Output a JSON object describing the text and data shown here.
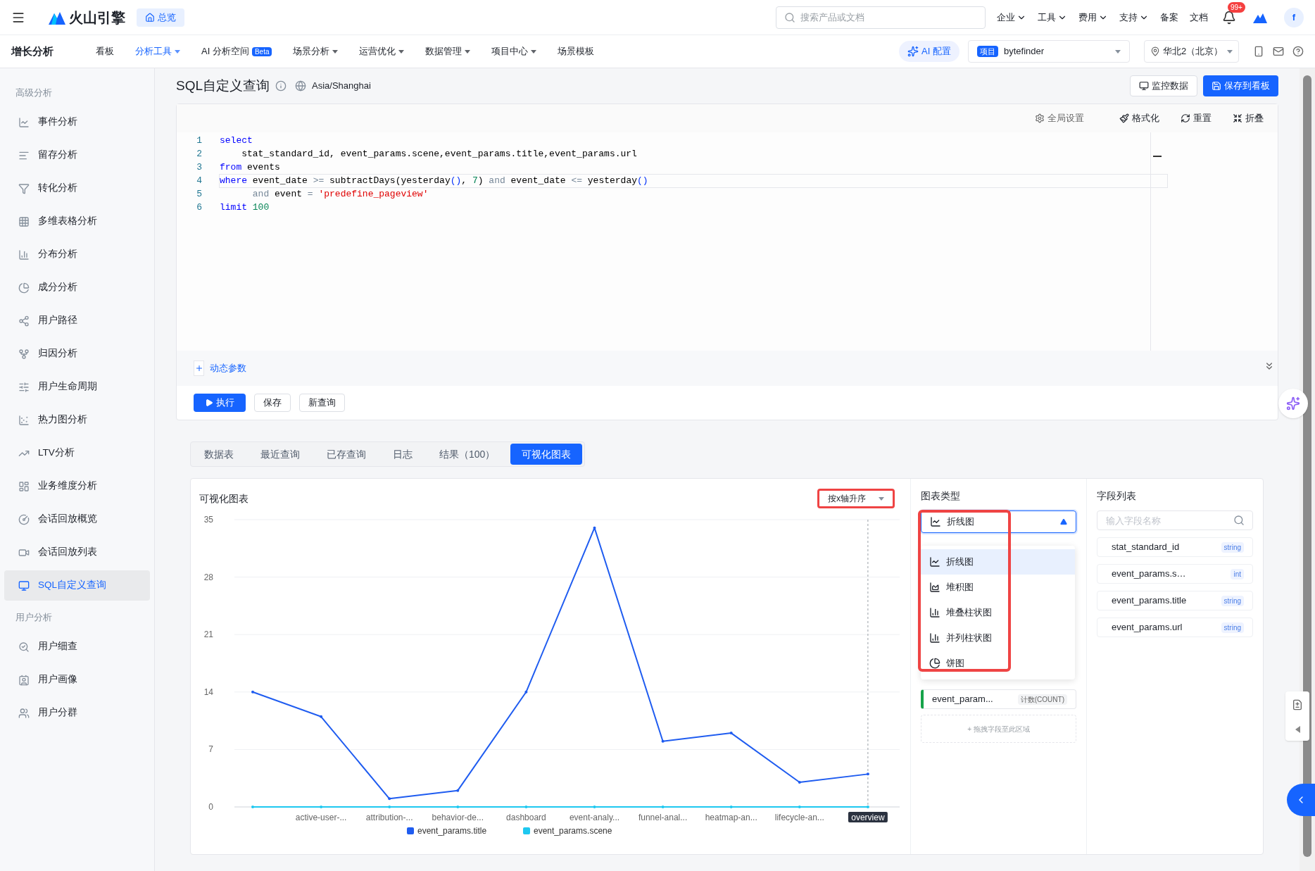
{
  "topbar": {
    "brand": "火山引擎",
    "overview_button": "总览",
    "search": {
      "placeholder": "搜索产品或文档"
    },
    "menus": [
      {
        "label": "企业",
        "dropdown": true
      },
      {
        "label": "工具",
        "dropdown": true
      },
      {
        "label": "费用",
        "dropdown": true
      },
      {
        "label": "支持",
        "dropdown": true
      },
      {
        "label": "备案",
        "dropdown": false
      },
      {
        "label": "文档",
        "dropdown": false
      }
    ],
    "notification_badge": "99+",
    "avatar": "f"
  },
  "navbar": {
    "title": "增长分析",
    "items": [
      {
        "label": "看板",
        "selected": false,
        "dropdown": false
      },
      {
        "label": "分析工具",
        "selected": true,
        "dropdown": true
      },
      {
        "label": "AI 分析空间",
        "selected": false,
        "dropdown": false,
        "badge": "Beta"
      },
      {
        "label": "场景分析",
        "selected": false,
        "dropdown": true
      },
      {
        "label": "运营优化",
        "selected": false,
        "dropdown": true
      },
      {
        "label": "数据管理",
        "selected": false,
        "dropdown": true
      },
      {
        "label": "项目中心",
        "selected": false,
        "dropdown": true
      },
      {
        "label": "场景模板",
        "selected": false,
        "dropdown": false
      }
    ],
    "ai_button": "AI 配置",
    "project": {
      "tag": "项目",
      "value": "bytefinder"
    },
    "region": "华北2（北京）"
  },
  "sidebar": {
    "sections": [
      {
        "title": "高级分析",
        "items": [
          {
            "label": "事件分析",
            "selected": false
          },
          {
            "label": "留存分析",
            "selected": false
          },
          {
            "label": "转化分析",
            "selected": false
          },
          {
            "label": "多维表格分析",
            "selected": false
          },
          {
            "label": "分布分析",
            "selected": false
          },
          {
            "label": "成分分析",
            "selected": false
          },
          {
            "label": "用户路径",
            "selected": false
          },
          {
            "label": "归因分析",
            "selected": false
          },
          {
            "label": "用户生命周期",
            "selected": false
          },
          {
            "label": "热力图分析",
            "selected": false
          },
          {
            "label": "LTV分析",
            "selected": false
          },
          {
            "label": "业务维度分析",
            "selected": false
          },
          {
            "label": "会话回放概览",
            "selected": false
          },
          {
            "label": "会话回放列表",
            "selected": false
          },
          {
            "label": "SQL自定义查询",
            "selected": true
          }
        ]
      },
      {
        "title": "用户分析",
        "items": [
          {
            "label": "用户细查",
            "selected": false
          },
          {
            "label": "用户画像",
            "selected": false
          },
          {
            "label": "用户分群",
            "selected": false
          }
        ]
      }
    ]
  },
  "page": {
    "title": "SQL自定义查询",
    "timezone": "Asia/Shanghai",
    "actions": [
      {
        "label": "监控数据",
        "primary": false
      },
      {
        "label": "保存到看板",
        "primary": true
      }
    ]
  },
  "editor": {
    "toolbar": [
      "全局设置",
      "格式化",
      "重置",
      "折叠"
    ],
    "lines": [
      {
        "number": "1",
        "current": false,
        "tokens": [
          {
            "text": "select",
            "kind": "keyword"
          }
        ]
      },
      {
        "number": "2",
        "current": false,
        "tokens": [
          {
            "text": "    stat_standard_id, event_params.scene,event_params.title,event_params.url",
            "kind": "plain"
          }
        ]
      },
      {
        "number": "3",
        "current": false,
        "tokens": [
          {
            "text": "from",
            "kind": "keyword"
          },
          {
            "text": " events",
            "kind": "plain"
          }
        ]
      },
      {
        "number": "4",
        "current": true,
        "tokens": [
          {
            "text": "where",
            "kind": "keyword"
          },
          {
            "text": " event_date ",
            "kind": "plain"
          },
          {
            "text": ">=",
            "kind": "operator"
          },
          {
            "text": " subtractDays",
            "kind": "plain"
          },
          {
            "text": "(",
            "kind": "paren"
          },
          {
            "text": "yesterday",
            "kind": "plain"
          },
          {
            "text": "()",
            "kind": "bracket"
          },
          {
            "text": ", ",
            "kind": "plain"
          },
          {
            "text": "7",
            "kind": "number"
          },
          {
            "text": ")",
            "kind": "paren"
          },
          {
            "text": " and",
            "kind": "operator"
          },
          {
            "text": " event_date ",
            "kind": "plain"
          },
          {
            "text": "<=",
            "kind": "operator"
          },
          {
            "text": " yesterday",
            "kind": "plain"
          },
          {
            "text": "()",
            "kind": "bracket"
          }
        ]
      },
      {
        "number": "5",
        "current": false,
        "tokens": [
          {
            "text": "      and",
            "kind": "operator"
          },
          {
            "text": " event ",
            "kind": "plain"
          },
          {
            "text": "=",
            "kind": "operator"
          },
          {
            "text": " 'predefine_pageview'",
            "kind": "string"
          }
        ]
      },
      {
        "number": "6",
        "current": false,
        "tokens": [
          {
            "text": "limit",
            "kind": "keyword"
          },
          {
            "text": " 100",
            "kind": "number"
          }
        ]
      }
    ],
    "params_label": "动态参数",
    "buttons": [
      {
        "label": "执行",
        "primary": true
      },
      {
        "label": "保存",
        "primary": false
      },
      {
        "label": "新查询",
        "primary": false
      }
    ]
  },
  "result_tabs": [
    {
      "label": "数据表",
      "selected": false
    },
    {
      "label": "最近查询",
      "selected": false
    },
    {
      "label": "已存查询",
      "selected": false
    },
    {
      "label": "日志",
      "selected": false
    },
    {
      "label": "结果（100）",
      "selected": false
    },
    {
      "label": "可视化图表",
      "selected": true
    }
  ],
  "chart_panel": {
    "title": "可视化图表",
    "sort_select": {
      "value": "按x轴升序",
      "highlighted": true
    },
    "chart_data": {
      "type": "line",
      "categories": [
        null,
        "active-user-...",
        "attribution-...",
        "behavior-de...",
        "dashboard",
        "event-analy...",
        "funnel-anal...",
        "heatmap-an...",
        "lifecycle-an...",
        "overview"
      ],
      "yticks": [
        0,
        7,
        14,
        21,
        28,
        35
      ],
      "ylim": [
        0,
        35
      ],
      "grid": true,
      "legend": true,
      "ref_lines": [
        {
          "axis": "x",
          "value": "overview"
        }
      ],
      "series": [
        {
          "name": "event_params.title",
          "color": "#1f5cf0",
          "values": [
            14,
            11,
            1,
            2,
            14,
            34,
            8,
            9,
            3,
            4
          ]
        },
        {
          "name": "event_params.scene",
          "color": "#1ec8f0",
          "values": [
            0,
            0,
            0,
            0,
            0,
            0,
            0,
            0,
            0,
            0
          ]
        }
      ]
    }
  },
  "chart_type": {
    "title": "图表类型",
    "select": {
      "value": "折线图",
      "expanded": true,
      "highlighted": true
    },
    "options": [
      {
        "label": "折线图",
        "selected": true
      },
      {
        "label": "堆积图",
        "selected": false
      },
      {
        "label": "堆叠柱状图",
        "selected": false
      },
      {
        "label": "并列柱状图",
        "selected": false
      },
      {
        "label": "饼图",
        "selected": false
      }
    ],
    "metric": {
      "name": "event_param...",
      "aggregation": "计数(COUNT)"
    },
    "drop_hint": "+ 拖拽字段至此区域"
  },
  "field_list": {
    "title": "字段列表",
    "search": {
      "placeholder": "输入字段名称"
    },
    "fields": [
      {
        "name": "stat_standard_id",
        "type": "string"
      },
      {
        "name": "event_params.s…",
        "type": "int"
      },
      {
        "name": "event_params.title",
        "type": "string"
      },
      {
        "name": "event_params.url",
        "type": "string"
      }
    ]
  }
}
